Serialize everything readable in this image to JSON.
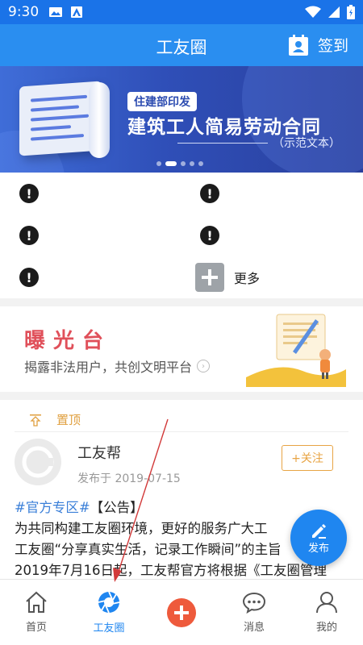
{
  "status_bar": {
    "time": "9:30"
  },
  "header": {
    "title": "工友圈",
    "signin_label": "签到"
  },
  "banner": {
    "badge": "住建部印发",
    "headline": "建筑工人简易劳动合同",
    "subtitle": "（示范文本）",
    "active_slide": 2,
    "slide_count": 5
  },
  "grid": {
    "more_label": "更多"
  },
  "exposure": {
    "title": "曝光台",
    "description": "揭露非法用户，共创文明平台"
  },
  "feed": {
    "pinned_label": "置顶",
    "post": {
      "author": "工友帮",
      "date": "发布于 2019-07-15",
      "follow_label": "+关注",
      "tag": "#官方专区#",
      "line1_rest": "【公告】",
      "line2": "为共同构建工友圈环境，更好的服务广大工",
      "line3": "工友圈“分享真实生活，记录工作瞬间”的主旨",
      "line4": "2019年7月16日起，工友帮官方将根据《工友圈管理"
    }
  },
  "fab": {
    "label": "发布"
  },
  "bottom_nav": {
    "items": [
      {
        "label": "首页",
        "icon": "home-icon"
      },
      {
        "label": "工友圈",
        "icon": "aperture-icon"
      },
      {
        "label": "",
        "icon": "plus-icon"
      },
      {
        "label": "消息",
        "icon": "message-icon"
      },
      {
        "label": "我的",
        "icon": "user-icon"
      }
    ],
    "active_index": 1
  },
  "colors": {
    "primary": "#2a8ef0",
    "status_bar": "#1a73e8",
    "exposure_title": "#e0505a",
    "follow": "#e8a444",
    "pinned": "#e0a040",
    "plus_button": "#ee5a3c"
  }
}
